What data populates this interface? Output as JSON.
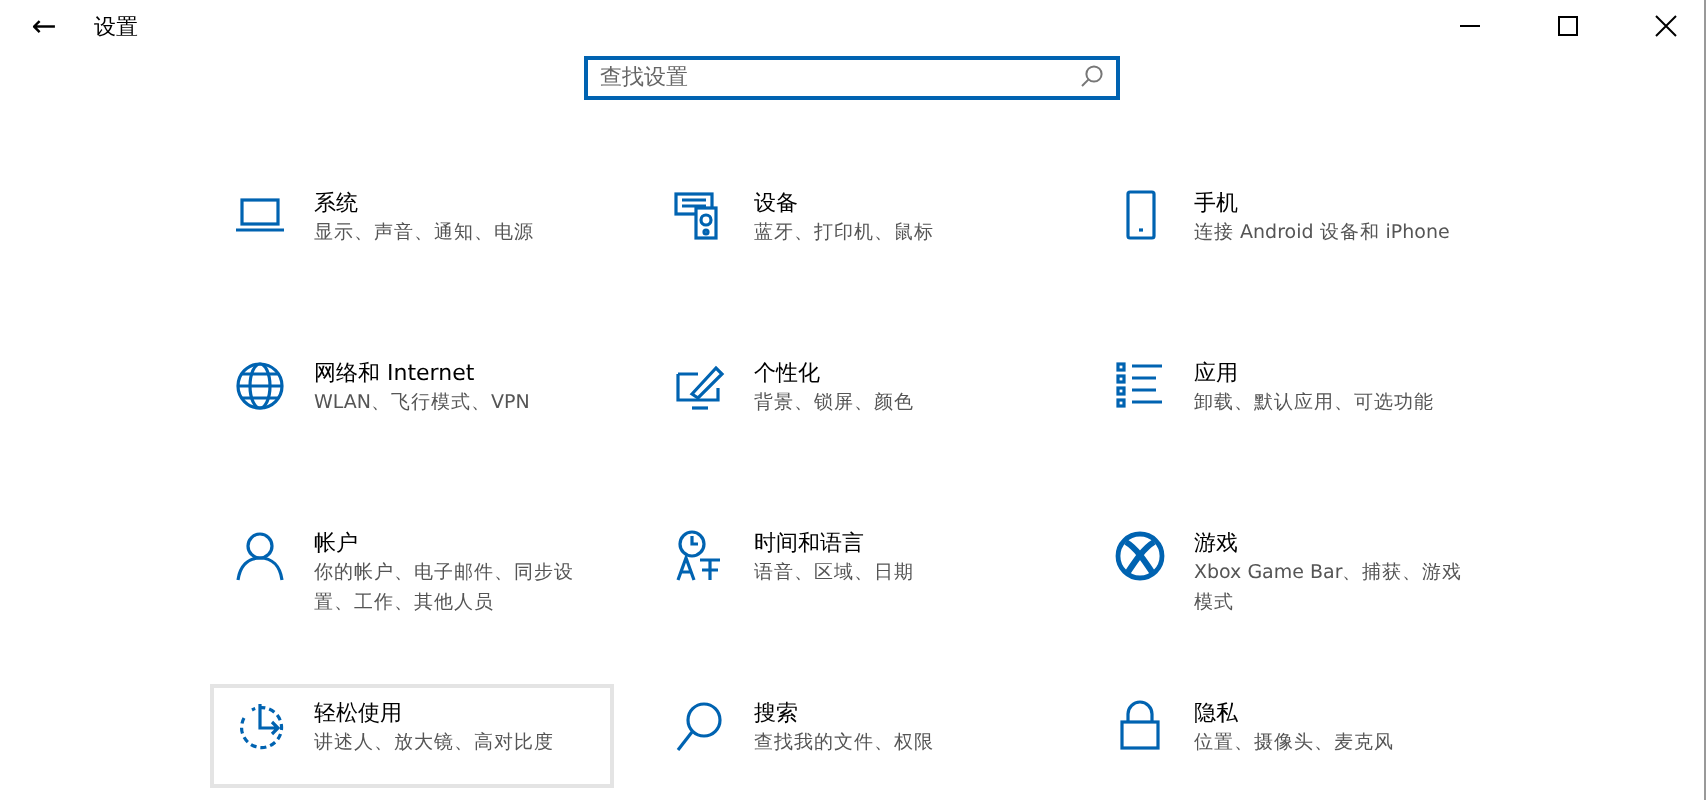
{
  "window": {
    "title": "设置",
    "back": "←"
  },
  "search": {
    "placeholder": "查找设置"
  },
  "tiles": [
    {
      "title": "系统",
      "desc": "显示、声音、通知、电源",
      "hovered": false
    },
    {
      "title": "设备",
      "desc": "蓝牙、打印机、鼠标",
      "hovered": false
    },
    {
      "title": "手机",
      "desc": "连接 Android 设备和 iPhone",
      "hovered": false
    },
    {
      "title": "网络和 Internet",
      "desc": "WLAN、飞行模式、VPN",
      "hovered": false
    },
    {
      "title": "个性化",
      "desc": "背景、锁屏、颜色",
      "hovered": false
    },
    {
      "title": "应用",
      "desc": "卸载、默认应用、可选功能",
      "hovered": false
    },
    {
      "title": "帐户",
      "desc": "你的帐户、电子邮件、同步设置、工作、其他人员",
      "hovered": false
    },
    {
      "title": "时间和语言",
      "desc": "语音、区域、日期",
      "hovered": false
    },
    {
      "title": "游戏",
      "desc": "Xbox Game Bar、捕获、游戏模式",
      "hovered": false
    },
    {
      "title": "轻松使用",
      "desc": "讲述人、放大镜、高对比度",
      "hovered": true
    },
    {
      "title": "搜索",
      "desc": "查找我的文件、权限",
      "hovered": false
    },
    {
      "title": "隐私",
      "desc": "位置、摄像头、麦克风",
      "hovered": false
    }
  ]
}
